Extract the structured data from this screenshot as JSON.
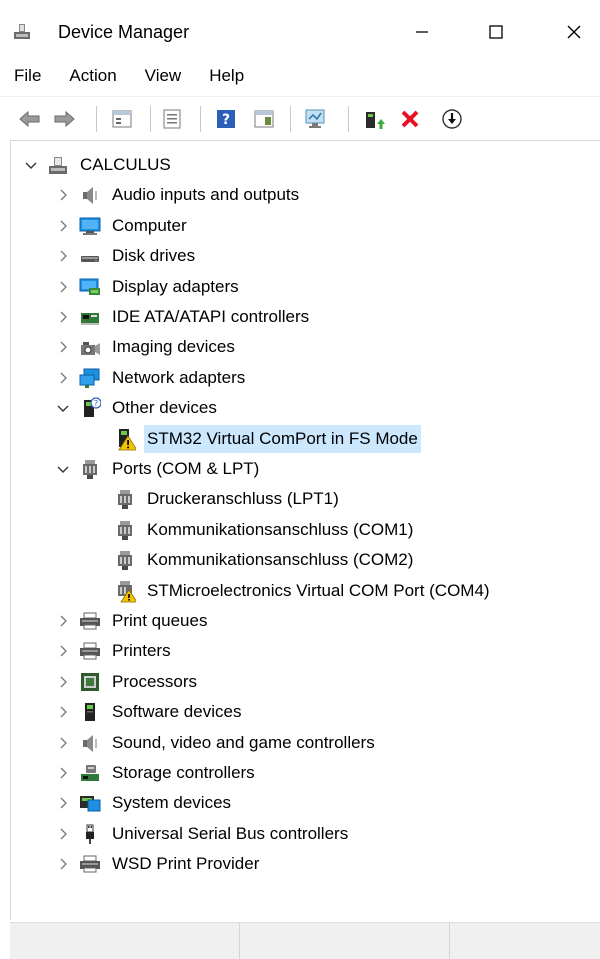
{
  "window": {
    "title": "Device Manager"
  },
  "menu": [
    "File",
    "Action",
    "View",
    "Help"
  ],
  "toolbar": [
    {
      "name": "back-icon"
    },
    {
      "name": "forward-icon"
    },
    {
      "name": "properties-icon"
    },
    {
      "name": "show-hidden-icon"
    },
    {
      "name": "help-icon"
    },
    {
      "name": "action-view-icon"
    },
    {
      "name": "scan-hardware-icon"
    },
    {
      "name": "update-driver-icon"
    },
    {
      "name": "uninstall-icon"
    },
    {
      "name": "enable-device-icon"
    }
  ],
  "tree": {
    "root": "CALCULUS",
    "items": [
      {
        "label": "Audio inputs and outputs",
        "icon": "speaker-icon",
        "level": 1,
        "expanded": false
      },
      {
        "label": "Computer",
        "icon": "monitor-icon",
        "level": 1,
        "expanded": false
      },
      {
        "label": "Disk drives",
        "icon": "disk-drive-icon",
        "level": 1,
        "expanded": false
      },
      {
        "label": "Display adapters",
        "icon": "display-adapter-icon",
        "level": 1,
        "expanded": false
      },
      {
        "label": "IDE ATA/ATAPI controllers",
        "icon": "ide-controller-icon",
        "level": 1,
        "expanded": false
      },
      {
        "label": "Imaging devices",
        "icon": "camera-icon",
        "level": 1,
        "expanded": false
      },
      {
        "label": "Network adapters",
        "icon": "network-icon",
        "level": 1,
        "expanded": false
      },
      {
        "label": "Other devices",
        "icon": "unknown-device-icon",
        "level": 1,
        "expanded": true
      },
      {
        "label": "STM32 Virtual ComPort in FS Mode",
        "icon": "warning-device-icon",
        "level": 2,
        "selected": true
      },
      {
        "label": "Ports (COM & LPT)",
        "icon": "port-icon",
        "level": 1,
        "expanded": true
      },
      {
        "label": "Druckeranschluss (LPT1)",
        "icon": "port-icon",
        "level": 2
      },
      {
        "label": "Kommunikationsanschluss (COM1)",
        "icon": "port-icon",
        "level": 2
      },
      {
        "label": "Kommunikationsanschluss (COM2)",
        "icon": "port-icon",
        "level": 2
      },
      {
        "label": "STMicroelectronics Virtual COM Port (COM4)",
        "icon": "port-warning-icon",
        "level": 2
      },
      {
        "label": "Print queues",
        "icon": "printer-icon",
        "level": 1,
        "expanded": false
      },
      {
        "label": "Printers",
        "icon": "printer-icon",
        "level": 1,
        "expanded": false
      },
      {
        "label": "Processors",
        "icon": "processor-icon",
        "level": 1,
        "expanded": false
      },
      {
        "label": "Software devices",
        "icon": "software-device-icon",
        "level": 1,
        "expanded": false
      },
      {
        "label": "Sound, video and game controllers",
        "icon": "speaker-icon",
        "level": 1,
        "expanded": false
      },
      {
        "label": "Storage controllers",
        "icon": "storage-controller-icon",
        "level": 1,
        "expanded": false
      },
      {
        "label": "System devices",
        "icon": "system-devices-icon",
        "level": 1,
        "expanded": false
      },
      {
        "label": "Universal Serial Bus controllers",
        "icon": "usb-icon",
        "level": 1,
        "expanded": false
      },
      {
        "label": "WSD Print Provider",
        "icon": "printer-icon",
        "level": 1,
        "expanded": false
      }
    ]
  },
  "colors": {
    "selection": "#cce8ff",
    "accent": "#0078d7",
    "warning": "#f5c400",
    "error": "#e81123"
  }
}
